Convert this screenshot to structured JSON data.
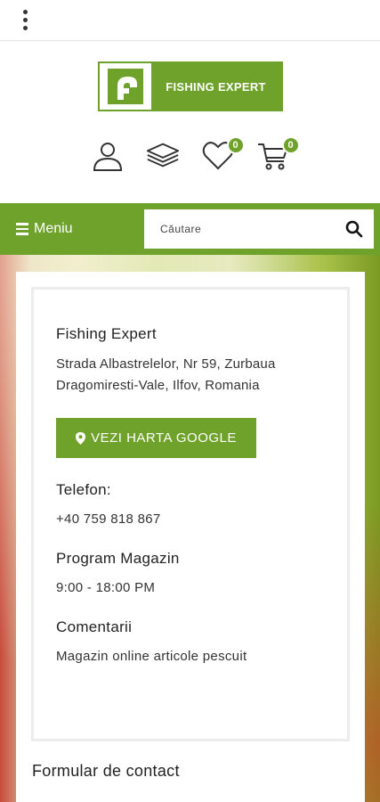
{
  "header": {
    "menu_icon": "kebab-menu-icon",
    "logo_text": "FISHING EXPERT",
    "wishlist_count": "0",
    "cart_count": "0"
  },
  "navbar": {
    "menu_label": "Meniu",
    "search_placeholder": "Căutare"
  },
  "contact": {
    "company": "Fishing Expert",
    "address_line1": "Strada Albastrelelor, Nr 59, Zurbaua",
    "address_line2": "Dragomiresti-Vale, Ilfov, Romania",
    "map_button": "VEZI HARTA GOOGLE",
    "phone_title": "Telefon:",
    "phone_value": "+40 759 818 867",
    "hours_title": "Program Magazin",
    "hours_value": "9:00 - 18:00 PM",
    "comments_title": "Comentarii",
    "comments_value": "Magazin online articole pescuit"
  },
  "form": {
    "title": "Formular de contact"
  },
  "colors": {
    "accent": "#6ea22a"
  }
}
